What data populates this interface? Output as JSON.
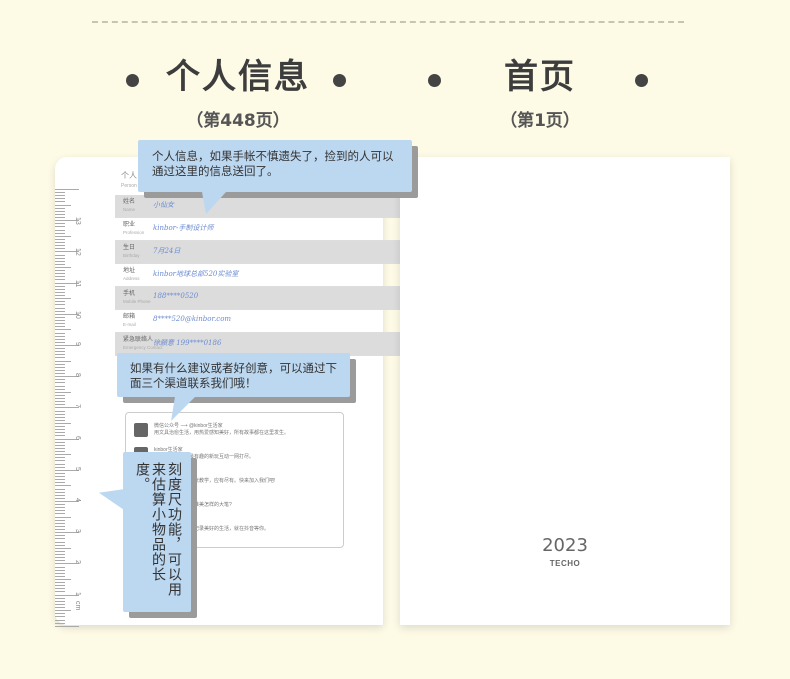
{
  "headings": {
    "left": {
      "title": "个人信息",
      "sub": "（第448页）"
    },
    "right": {
      "title": "首页",
      "sub": "（第1页）"
    }
  },
  "form": {
    "title": "个人",
    "title_en": "Person",
    "rows": [
      {
        "label": "姓名",
        "label_en": "Name",
        "value": "小仙女"
      },
      {
        "label": "职业",
        "label_en": "Profession",
        "value": "kinbor-手制设计师"
      },
      {
        "label": "生日",
        "label_en": "Birthday",
        "value": "7月24日"
      },
      {
        "label": "地址",
        "label_en": "Address",
        "value": "kinbor地球总部520实验室"
      },
      {
        "label": "手机",
        "label_en": "Mobile Phone",
        "value": "188****0520"
      },
      {
        "label": "邮箱",
        "label_en": "E-mail",
        "value": "8****520@kinbor.com"
      },
      {
        "label": "紧急联络人",
        "label_en": "Emergency Contact",
        "value": "徐願意 199****0186"
      }
    ]
  },
  "channels": [
    {
      "line1": "微信公众号 ⟶ @kinbor生活家",
      "line2": "用文具治愈生活，用热爱感知美好，所有故事都在这里发生。"
    },
    {
      "line1": "kinbor生活家",
      "line2": "新品上手资讯，最有趣的新玩互动一网打尽。"
    },
    {
      "line1": "@kinbor生活家",
      "line2": "新品新款介绍，手帐教学，应有尽有。快来加入我们吧!"
    },
    {
      "line1": "⟶ @kinbor生活家",
      "line2": "三分二次元，又将唯美怎样的大笔?"
    },
    {
      "line1": "kinbor生活家",
      "line2": "超多美好的瞬间，记录美好的生活，就在抖音等你。"
    }
  ],
  "bubbles": {
    "b1": "个人信息，如果手帐不慎遗失了，捡到的人可以通过这里的信息送回了。",
    "b2": "如果有什么建议或者好创意，可以通过下面三个渠道联系我们哦！",
    "b3": "刻度尺功能，可以用来估算小物品的长度。"
  },
  "ruler": {
    "unit": "cm",
    "numbers": [
      "13",
      "12",
      "11",
      "10",
      "9",
      "8",
      "7",
      "6",
      "5",
      "4",
      "3",
      "2",
      "1"
    ]
  },
  "cover": {
    "year": "2023",
    "brand": "TECHO"
  }
}
